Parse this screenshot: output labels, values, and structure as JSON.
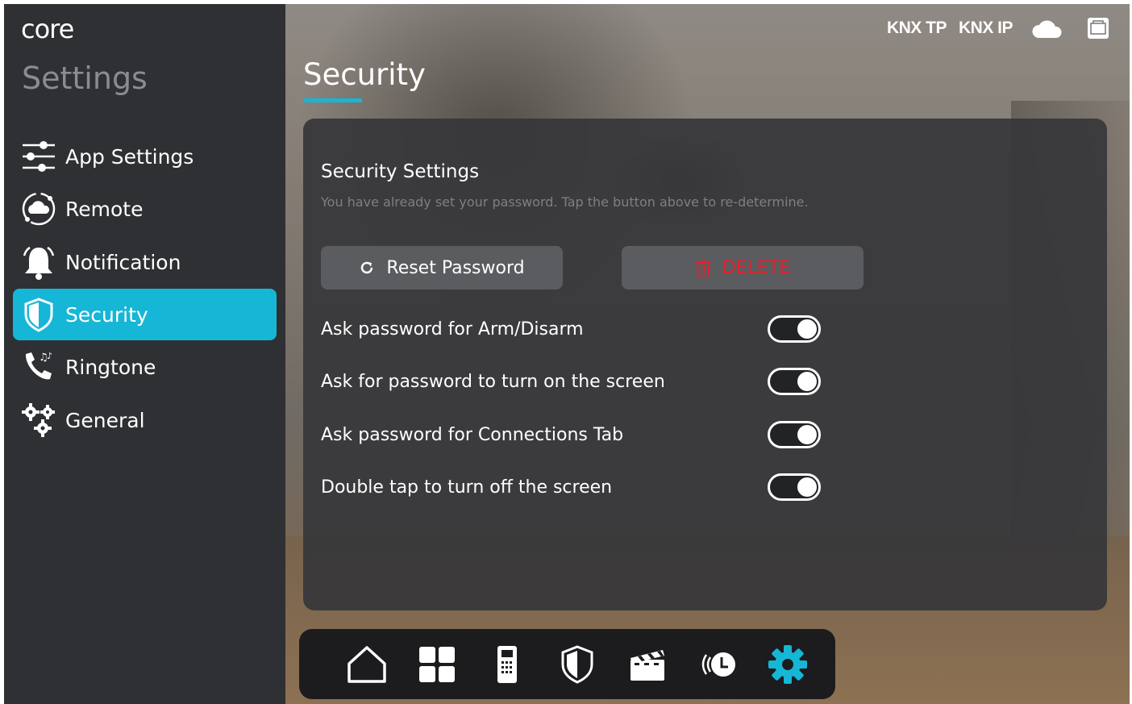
{
  "brand": {
    "logo_text": "core"
  },
  "sidebar": {
    "heading": "Settings",
    "items": [
      {
        "label": "App Settings",
        "icon": "sliders-icon"
      },
      {
        "label": "Remote",
        "icon": "cloud-sync-icon"
      },
      {
        "label": "Notification",
        "icon": "bell-icon"
      },
      {
        "label": "Security",
        "icon": "shield-icon",
        "active": true
      },
      {
        "label": "Ringtone",
        "icon": "phone-music-icon"
      },
      {
        "label": "General",
        "icon": "gears-icon"
      }
    ]
  },
  "statusbar": {
    "knx_tp": "KNX TP",
    "knx_ip": "KNX IP",
    "icons": [
      "cloud-icon",
      "ethernet-icon"
    ]
  },
  "main": {
    "title": "Security",
    "panel": {
      "section_title": "Security Settings",
      "section_desc": "You have already set your password. Tap the button above to re-determine.",
      "reset_label": "Reset Password",
      "delete_label": "DELETE",
      "toggles": [
        {
          "label": "Ask password for Arm/Disarm",
          "on": true
        },
        {
          "label": "Ask for password to turn on the screen",
          "on": true
        },
        {
          "label": "Ask password for Connections Tab",
          "on": true
        },
        {
          "label": "Double tap to turn off the screen",
          "on": true
        }
      ]
    }
  },
  "dock": {
    "items": [
      "home-icon",
      "grid-icon",
      "intercom-icon",
      "shield-icon",
      "clapperboard-icon",
      "schedule-icon",
      "settings-gear-icon"
    ],
    "active": "settings-gear-icon"
  },
  "colors": {
    "accent": "#16b6d6",
    "danger": "#e0222c",
    "sidebar_bg": "#2f3033",
    "panel_bg": "#37373a"
  }
}
